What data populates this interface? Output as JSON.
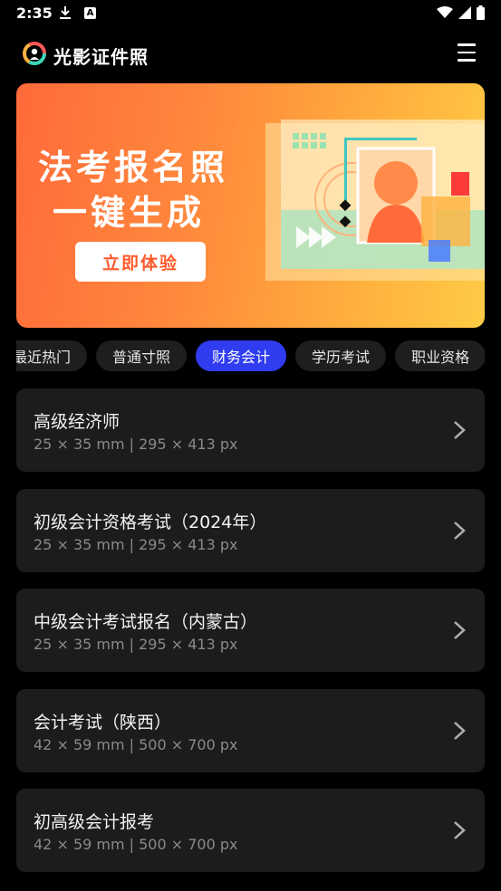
{
  "status_bar": {
    "time": "2:35"
  },
  "app": {
    "title": "光影证件照"
  },
  "banner": {
    "line1": "法考报名照",
    "line2": "一键生成",
    "button": "立即体验"
  },
  "tabs": [
    {
      "label": "最近热门",
      "active": false
    },
    {
      "label": "普通寸照",
      "active": false
    },
    {
      "label": "财务会计",
      "active": true
    },
    {
      "label": "学历考试",
      "active": false
    },
    {
      "label": "职业资格",
      "active": false
    }
  ],
  "items": [
    {
      "title": "高级经济师",
      "size": "25 × 35 mm | 295 × 413 px"
    },
    {
      "title": "初级会计资格考试（2024年）",
      "size": "25 × 35 mm | 295 × 413 px"
    },
    {
      "title": "中级会计考试报名（内蒙古）",
      "size": "25 × 35 mm | 295 × 413 px"
    },
    {
      "title": "会计考试（陕西）",
      "size": "42 × 59 mm | 500 × 700 px"
    },
    {
      "title": "初高级会计报考",
      "size": "42 × 59 mm | 500 × 700 px"
    }
  ],
  "colors": {
    "accent": "#2f3cf0",
    "banner_start": "#ff6a3a",
    "banner_end": "#ffcb45"
  }
}
